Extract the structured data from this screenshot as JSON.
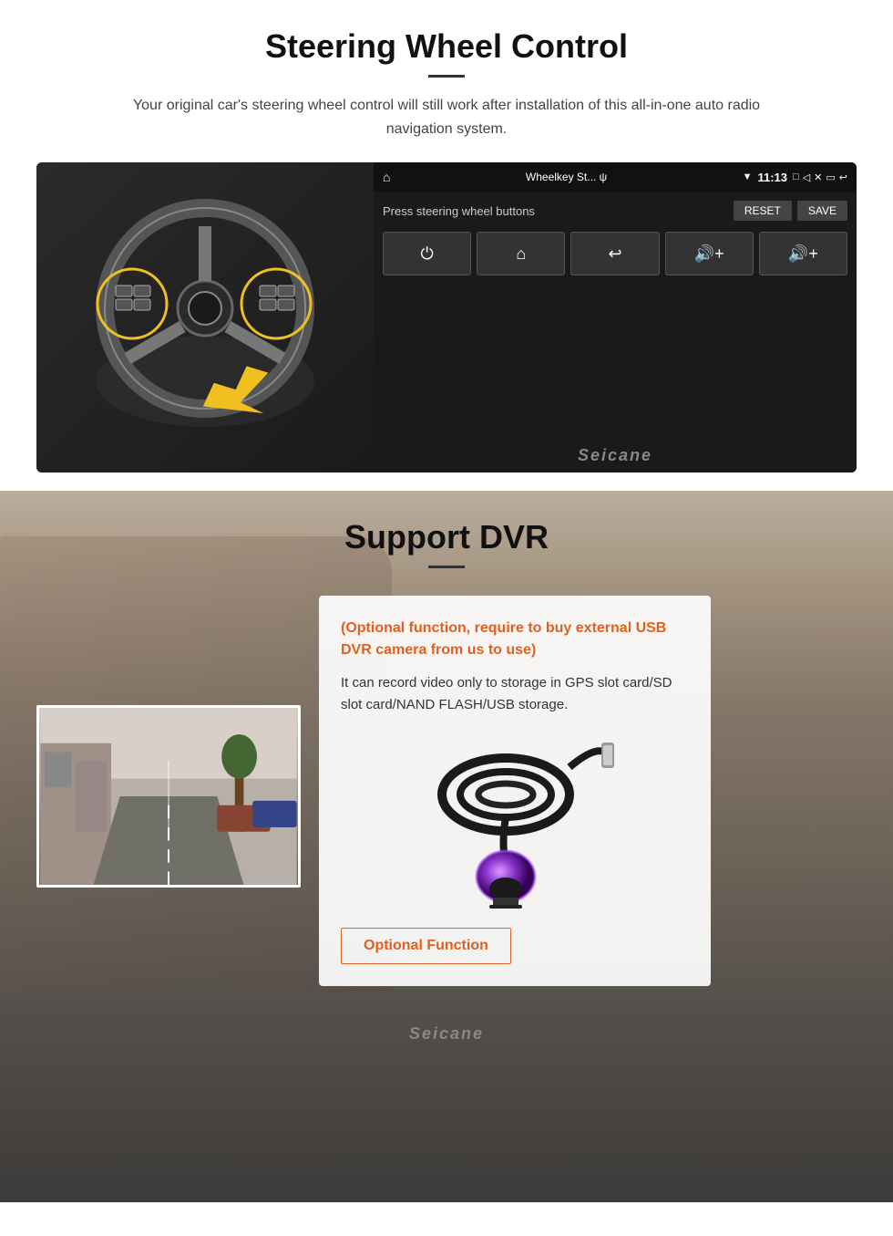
{
  "steering": {
    "title": "Steering Wheel Control",
    "description": "Your original car's steering wheel control will still work after installation of this all-in-one auto radio navigation system.",
    "ui": {
      "app_name": "Wheelkey St... ψ",
      "time": "11:13",
      "label": "Press steering wheel buttons",
      "reset_btn": "RESET",
      "save_btn": "SAVE",
      "buttons": [
        "⏻",
        "⌂",
        "↩",
        "🔊+",
        "🔊+"
      ]
    },
    "watermark": "Seicane"
  },
  "dvr": {
    "title": "Support DVR",
    "optional_text": "(Optional function, require to buy external USB DVR camera from us to use)",
    "description": "It can record video only to storage in GPS slot card/SD slot card/NAND FLASH/USB storage.",
    "optional_badge": "Optional Function",
    "watermark": "Seicane"
  }
}
